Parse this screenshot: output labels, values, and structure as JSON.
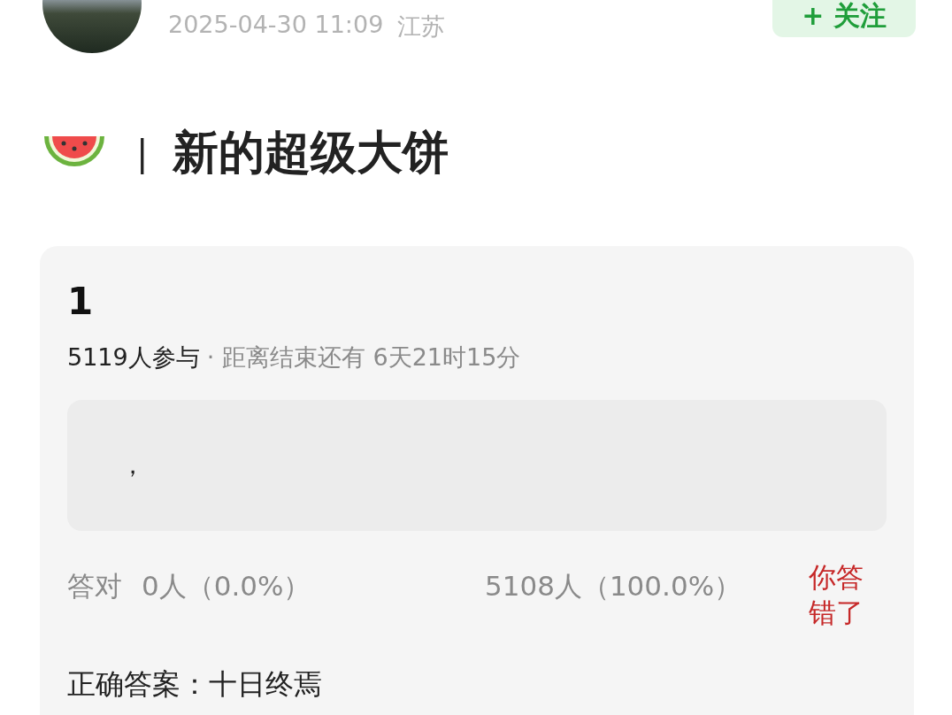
{
  "post": {
    "timestamp": "2025-04-30 11:09",
    "location": "江苏",
    "follow_button": "+ 关注",
    "separator": "|",
    "title": "新的超级大饼"
  },
  "quiz": {
    "number": "1",
    "participants": "5119人参与",
    "remaining": "· 距离结束还有 6天21时15分",
    "option_text": "，",
    "correct_label": "答对",
    "correct_count": "0人（0.0%）",
    "wrong_count": "5108人（100.0%）",
    "result": "你答错了",
    "answer": "正确答案：十日终焉"
  }
}
